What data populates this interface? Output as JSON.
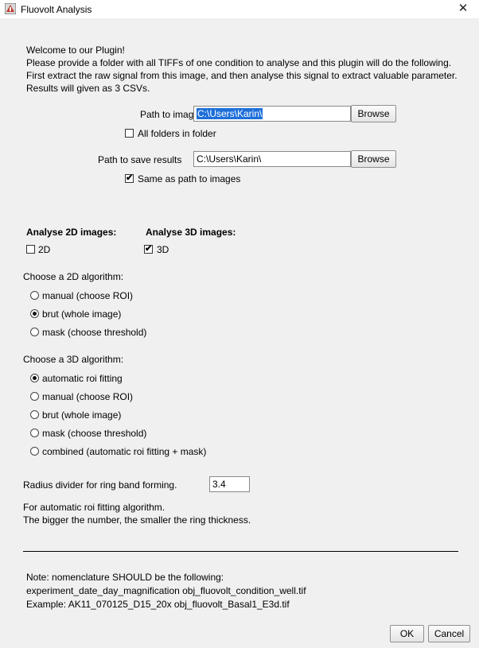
{
  "window": {
    "title": "Fluovolt Analysis",
    "close_glyph": "✕"
  },
  "intro": {
    "lines": [
      "Welcome to our Plugin!",
      "Please provide a folder with all TIFFs of one condition to analyse and this plugin will do the following.",
      "First extract the raw signal from this image, and then analyse this signal to extract valuable parameter.",
      "Results will given as 3 CSVs."
    ]
  },
  "images_path": {
    "label": "Path to images",
    "value": "C:\\Users\\Karin\\",
    "browse_label": "Browse"
  },
  "all_folders": {
    "label": "All folders in folder",
    "checked": false
  },
  "results_path": {
    "label": "Path to save results",
    "value": "C:\\Users\\Karin\\",
    "browse_label": "Browse"
  },
  "same_as_images": {
    "label": "Same as path to images",
    "checked": true
  },
  "analyse_2d": {
    "heading": "Analyse 2D images:",
    "label": "2D",
    "checked": false
  },
  "analyse_3d": {
    "heading": "Analyse 3D images:",
    "label": "3D",
    "checked": true
  },
  "algo_2d": {
    "heading": "Choose a 2D algorithm:",
    "options": [
      {
        "label": "manual (choose ROI)",
        "selected": false
      },
      {
        "label": "brut (whole image)",
        "selected": true
      },
      {
        "label": "mask (choose threshold)",
        "selected": false
      }
    ]
  },
  "algo_3d": {
    "heading": "Choose a 3D algorithm:",
    "options": [
      {
        "label": "automatic roi fitting",
        "selected": true
      },
      {
        "label": "manual (choose ROI)",
        "selected": false
      },
      {
        "label": "brut (whole image)",
        "selected": false
      },
      {
        "label": "mask (choose threshold)",
        "selected": false
      },
      {
        "label": "combined (automatic roi fitting + mask)",
        "selected": false
      }
    ]
  },
  "radius": {
    "label": "Radius divider for ring band forming.",
    "value": "3.4",
    "help_lines": [
      "For automatic roi fitting algorithm.",
      "The bigger the number, the smaller the ring thickness."
    ]
  },
  "note": {
    "lines": [
      "Note: nomenclature SHOULD be the following:",
      "experiment_date_day_magnification obj_fluovolt_condition_well.tif",
      "Example: AK11_070125_D15_20x obj_fluovolt_Basal1_E3d.tif"
    ]
  },
  "buttons": {
    "ok": "OK",
    "cancel": "Cancel"
  }
}
